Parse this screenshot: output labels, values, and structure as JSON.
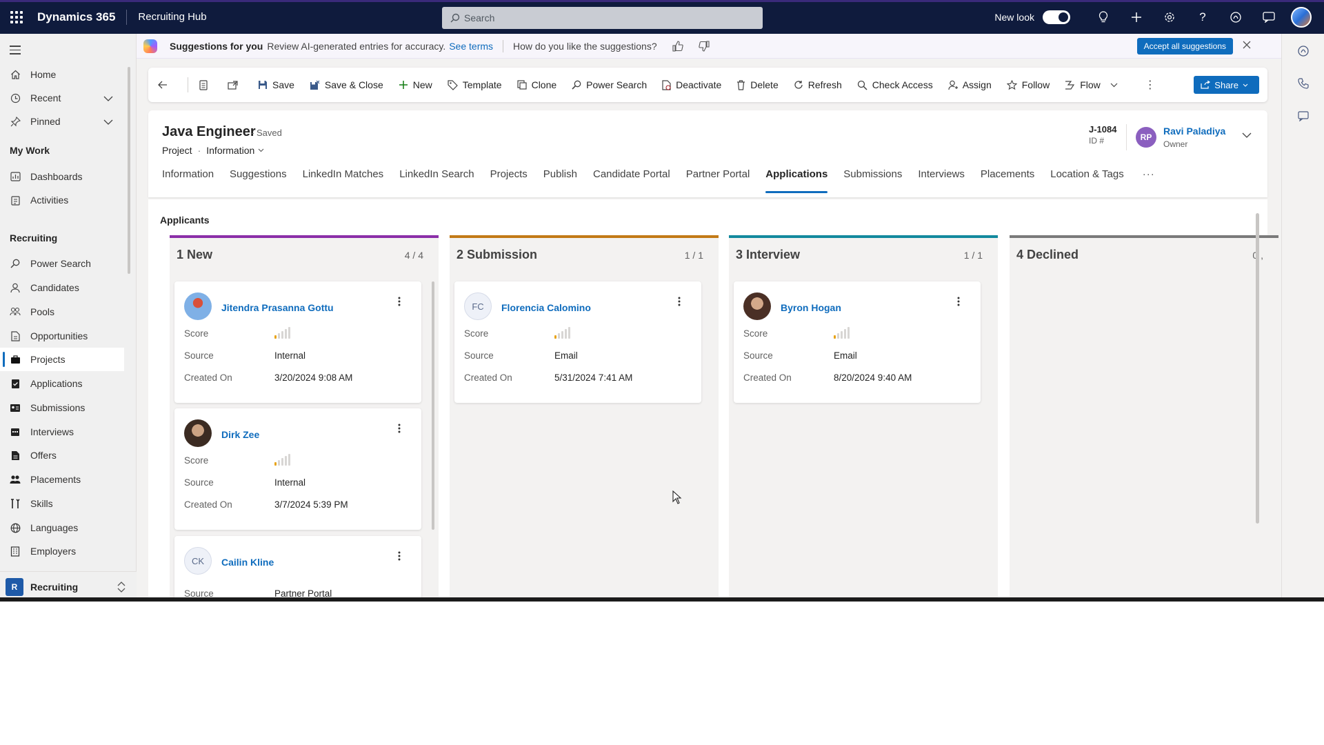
{
  "topbar": {
    "brand": "Dynamics 365",
    "hub": "Recruiting Hub",
    "search_placeholder": "Search",
    "new_look_label": "New look",
    "icons": [
      "lightbulb-icon",
      "plus-icon",
      "settings-icon",
      "help-icon",
      "copilot-icon",
      "chat-icon",
      "avatar"
    ]
  },
  "sidebar": {
    "items_top": [
      {
        "label": "Home",
        "icon": "home-icon"
      },
      {
        "label": "Recent",
        "icon": "clock-icon"
      },
      {
        "label": "Pinned",
        "icon": "pin-icon"
      }
    ],
    "my_work_header": "My Work",
    "my_work": [
      {
        "label": "Dashboards",
        "icon": "dashboard-icon"
      },
      {
        "label": "Activities",
        "icon": "clipboard-icon"
      }
    ],
    "recruiting_header": "Recruiting",
    "recruiting": [
      {
        "label": "Power Search"
      },
      {
        "label": "Candidates"
      },
      {
        "label": "Pools"
      },
      {
        "label": "Opportunities"
      },
      {
        "label": "Projects"
      },
      {
        "label": "Applications"
      },
      {
        "label": "Submissions"
      },
      {
        "label": "Interviews"
      },
      {
        "label": "Offers"
      },
      {
        "label": "Placements"
      },
      {
        "label": "Skills"
      },
      {
        "label": "Languages"
      },
      {
        "label": "Employers"
      }
    ],
    "area": {
      "badge": "R",
      "label": "Recruiting"
    }
  },
  "suggestions": {
    "title": "Suggestions for you",
    "text": "Review AI-generated entries for accuracy.",
    "link": "See terms",
    "question": "How do you like the suggestions?",
    "accept_label": "Accept all suggestions"
  },
  "commands": {
    "save": "Save",
    "save_close": "Save & Close",
    "new": "New",
    "template": "Template",
    "clone": "Clone",
    "power_search": "Power Search",
    "deactivate": "Deactivate",
    "delete": "Delete",
    "refresh": "Refresh",
    "check_access": "Check Access",
    "assign": "Assign",
    "follow": "Follow",
    "flow": "Flow",
    "share": "Share"
  },
  "record": {
    "title": "Java Engineer",
    "saved": "- Saved",
    "entity": "Project",
    "form": "Information",
    "id_value": "J-1084",
    "id_label": "ID #",
    "owner_initials": "RP",
    "owner_name": "Ravi Paladiya",
    "owner_label": "Owner"
  },
  "tabs": [
    {
      "label": "Information"
    },
    {
      "label": "Suggestions"
    },
    {
      "label": "LinkedIn Matches"
    },
    {
      "label": "LinkedIn Search"
    },
    {
      "label": "Projects"
    },
    {
      "label": "Publish"
    },
    {
      "label": "Candidate Portal"
    },
    {
      "label": "Partner Portal"
    },
    {
      "label": "Applications",
      "active": true
    },
    {
      "label": "Submissions"
    },
    {
      "label": "Interviews"
    },
    {
      "label": "Placements"
    },
    {
      "label": "Location & Tags"
    }
  ],
  "board": {
    "title": "Applicants",
    "labels": {
      "score": "Score",
      "source": "Source",
      "created_on": "Created On"
    },
    "columns": [
      {
        "title": "1 New",
        "count": "4 / 4",
        "color": "#8b2fa8",
        "cards": [
          {
            "name": "Jitendra Prasanna Gottu",
            "score_fraction": 0.2,
            "source": "Internal",
            "created_on": "3/20/2024 9:08 AM"
          },
          {
            "name": "Dirk Zee",
            "score_fraction": 0.2,
            "source": "Internal",
            "created_on": "3/7/2024 5:39 PM"
          },
          {
            "name": "Cailin Kline",
            "initials": "CK",
            "source": "Partner Portal"
          }
        ]
      },
      {
        "title": "2 Submission",
        "count": "1 / 1",
        "color": "#c27a17",
        "cards": [
          {
            "name": "Florencia Calomino",
            "initials": "FC",
            "score_fraction": 0.2,
            "source": "Email",
            "created_on": "5/31/2024 7:41 AM"
          }
        ]
      },
      {
        "title": "3 Interview",
        "count": "1 / 1",
        "color": "#138a9e",
        "cards": [
          {
            "name": "Byron Hogan",
            "score_fraction": 0.2,
            "source": "Email",
            "created_on": "8/20/2024 9:40 AM"
          }
        ]
      },
      {
        "title": "4 Declined",
        "count": "0 ,",
        "color": "#7a7a7a",
        "cards": []
      }
    ]
  },
  "colors": {
    "topbar": "#0f1b3d",
    "accent": "#0f6cbd",
    "score": "#e8a317"
  }
}
